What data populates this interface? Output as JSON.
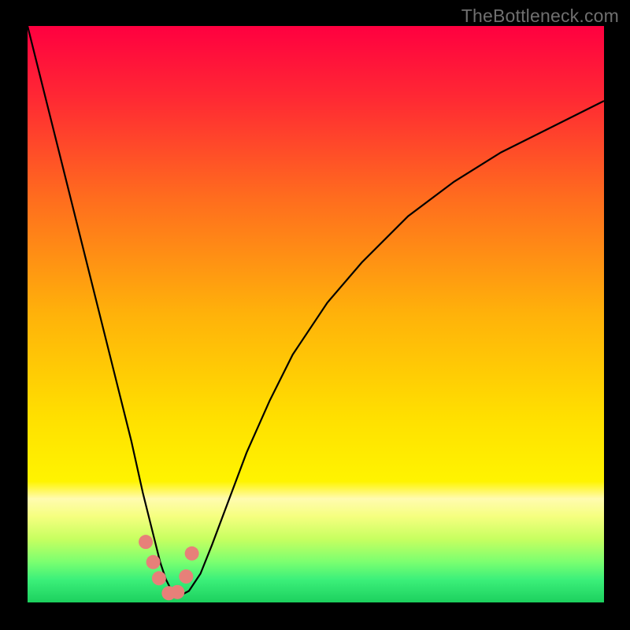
{
  "watermark": "TheBottleneck.com",
  "colors": {
    "gradient_stops": [
      {
        "pct": 0,
        "hex": "#ff0040"
      },
      {
        "pct": 12,
        "hex": "#ff2734"
      },
      {
        "pct": 30,
        "hex": "#ff6d1e"
      },
      {
        "pct": 50,
        "hex": "#ffb20a"
      },
      {
        "pct": 68,
        "hex": "#ffe000"
      },
      {
        "pct": 79,
        "hex": "#fff400"
      },
      {
        "pct": 82,
        "hex": "#fffbb0"
      },
      {
        "pct": 85,
        "hex": "#f6ff80"
      },
      {
        "pct": 89,
        "hex": "#c7ff60"
      },
      {
        "pct": 93,
        "hex": "#7aff70"
      },
      {
        "pct": 96,
        "hex": "#3cf07a"
      },
      {
        "pct": 100,
        "hex": "#1cd05e"
      }
    ],
    "curve_stroke": "#000000",
    "dot_fill": "#e78079",
    "frame_bg": "#000000"
  },
  "chart_data": {
    "type": "line",
    "title": "",
    "xlabel": "",
    "ylabel": "",
    "xlim": [
      0,
      100
    ],
    "ylim": [
      0,
      100
    ],
    "grid": false,
    "legend": false,
    "note": "Axes unlabeled in source; values are normalized 0-100 screen coords estimated from pixels. Lower y = bottom of plot = better (green).",
    "series": [
      {
        "name": "bottleneck-curve",
        "x": [
          0,
          2,
          4,
          6,
          8,
          10,
          12,
          14,
          16,
          18,
          20,
          22,
          23,
          24,
          25,
          26.5,
          28,
          30,
          32,
          35,
          38,
          42,
          46,
          52,
          58,
          66,
          74,
          82,
          90,
          100
        ],
        "y": [
          100,
          92,
          84,
          76,
          68,
          60,
          52,
          44,
          36,
          28,
          19,
          11,
          7,
          4,
          2,
          1.2,
          2,
          5,
          10,
          18,
          26,
          35,
          43,
          52,
          59,
          67,
          73,
          78,
          82,
          87
        ]
      }
    ],
    "marker_points": {
      "name": "highlight-dots",
      "x": [
        20.5,
        21.8,
        22.8,
        24.5,
        26.0,
        27.5,
        28.5
      ],
      "y": [
        10.5,
        7.0,
        4.2,
        1.6,
        1.8,
        4.5,
        8.5
      ]
    }
  }
}
